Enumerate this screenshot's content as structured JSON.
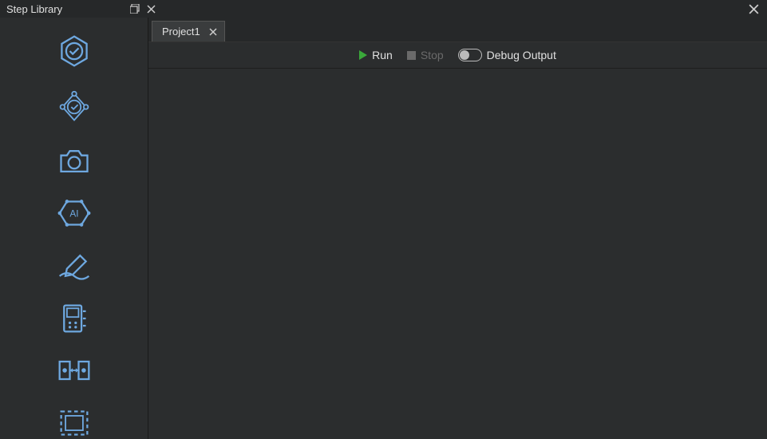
{
  "sidebar": {
    "title": "Step Library",
    "items": [
      {
        "name": "hexagon-check-icon"
      },
      {
        "name": "diamond-check-icon"
      },
      {
        "name": "camera-icon"
      },
      {
        "name": "ai-hexagon-icon"
      },
      {
        "name": "pen-wave-icon"
      },
      {
        "name": "device-icon"
      },
      {
        "name": "align-horizontal-icon"
      },
      {
        "name": "dashed-rect-icon"
      }
    ]
  },
  "tabs": [
    {
      "label": "Project1"
    }
  ],
  "toolbar": {
    "run_label": "Run",
    "stop_label": "Stop",
    "debug_label": "Debug Output",
    "debug_on": false
  }
}
